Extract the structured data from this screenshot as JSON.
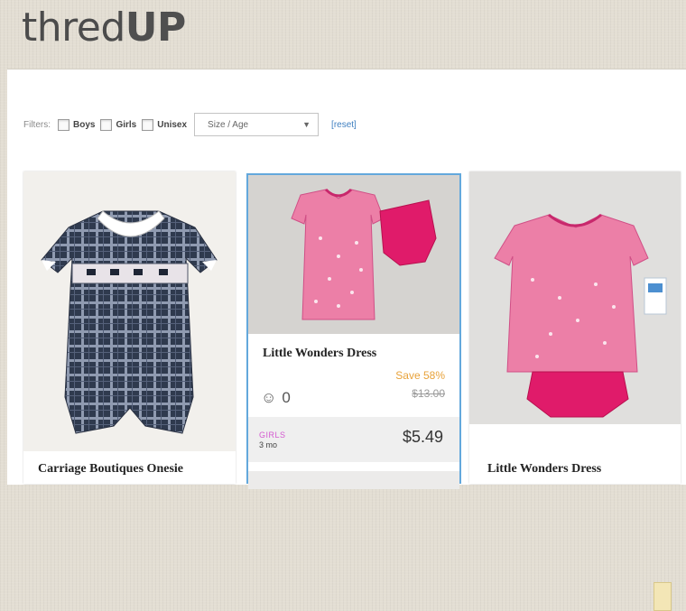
{
  "logo": {
    "text_a": "thr",
    "text_b": "ed",
    "text_c": "UP"
  },
  "filters": {
    "label": "Filters:",
    "options": [
      {
        "label": "Boys"
      },
      {
        "label": "Girls"
      },
      {
        "label": "Unisex"
      }
    ],
    "select_value": "Size / Age",
    "reset": "[reset]"
  },
  "products": [
    {
      "title": "Carriage Boutiques Onesie"
    },
    {
      "title": "Little Wonders Dress",
      "likes": "0",
      "save": "Save 58%",
      "original_price": "$13.00",
      "gender": "GIRLS",
      "size": "3 mo",
      "price": "$5.49"
    },
    {
      "title": "Little Wonders Dress"
    }
  ],
  "icons": {
    "like": "smiley-face-icon",
    "dropdown": "triangle-down-icon"
  },
  "colors": {
    "selected_border": "#63a8dc",
    "save_orange": "#e8a23a",
    "gender_pink": "#d45ad0",
    "link_blue": "#3f7fc0"
  }
}
